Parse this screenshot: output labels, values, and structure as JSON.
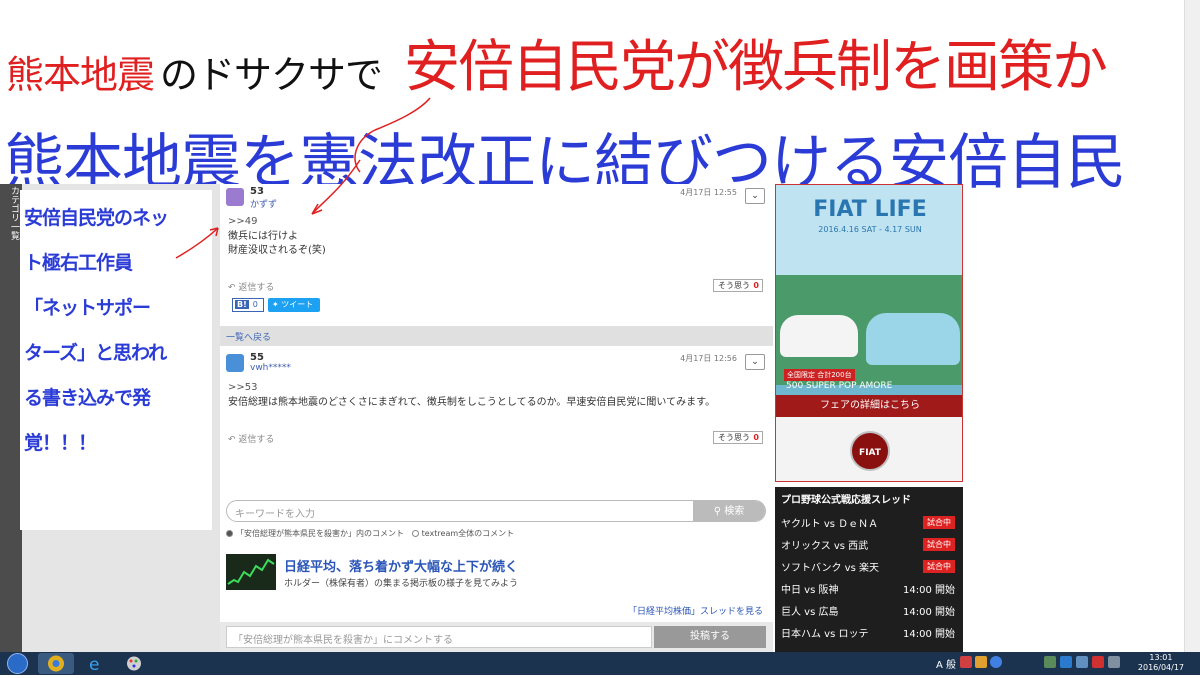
{
  "headline1": {
    "part1": "熊本地震",
    "part2": "のドサクサで",
    "part3": "安倍自民党が徴兵制を画策か"
  },
  "headline2": "熊本地震を憲法改正に結びつける安倍自民",
  "sidebar_category": "カテゴリ一覧",
  "annotation_lines": [
    "安倍自民党のネッ",
    "ト極右工作員",
    "「ネットサポー",
    "ターズ」と思われ",
    "る書き込みで発",
    "覚！！！"
  ],
  "comment53": {
    "num": "53",
    "name": "かずず",
    "date": "4月17日 12:55",
    "ref": ">>49",
    "body1": "徴兵には行けよ",
    "body2": "財産没収されるぞ(笑)",
    "reply": "返信する",
    "sou": "そう思う",
    "sou_count": "0",
    "bm_count": "0",
    "tweet": "ツイート"
  },
  "back_link": "一覧へ戻る",
  "comment55": {
    "num": "55",
    "name": "vwh*****",
    "date": "4月17日 12:56",
    "ref": ">>53",
    "body": "安倍総理は熊本地震のどさくさにまぎれて、徴兵制をしこうとしてるのか。早速安倍自民党に聞いてみます。",
    "reply": "返信する",
    "sou": "そう思う",
    "sou_count": "0"
  },
  "search": {
    "placeholder": "キーワードを入力",
    "button": "検索",
    "radio1": "「安倍総理が熊本県民を殺害か」内のコメント",
    "radio2": "textream全体のコメント"
  },
  "nikkei": {
    "title": "日経平均、落ち着かず大幅な上下が続く",
    "sub": "ホルダー（株保有者）の集まる掲示板の様子を見てみよう",
    "link": "「日経平均株価」スレッドを見る"
  },
  "bottom_comment": {
    "placeholder": "「安倍総理が熊本県民を殺害か」にコメントする",
    "post": "投稿する"
  },
  "ad": {
    "title": "FIAT LIFE",
    "date": "2016.4.16 SAT - 4.17 SUN",
    "limited": "全国限定 合計200台",
    "pop": "500 SUPER POP AMORE",
    "cta": "フェアの詳細はこちら",
    "logo": "FIAT"
  },
  "baseball": {
    "head": "プロ野球公式戦応援スレッド",
    "games": [
      {
        "teams": "ヤクルト vs ＤｅＮＡ",
        "status": "試合中",
        "live": true
      },
      {
        "teams": "オリックス vs 西武",
        "status": "試合中",
        "live": true
      },
      {
        "teams": "ソフトバンク vs 楽天",
        "status": "試合中",
        "live": true
      },
      {
        "teams": "中日 vs 阪神",
        "status": "14:00 開始",
        "live": false
      },
      {
        "teams": "巨人 vs 広島",
        "status": "14:00 開始",
        "live": false
      },
      {
        "teams": "日本ハム vs ロッテ",
        "status": "14:00 開始",
        "live": false
      }
    ]
  },
  "taskbar": {
    "ime": "A 般",
    "time": "13:01",
    "date": "2016/04/17"
  },
  "colors": {
    "headline_red": "#e02020",
    "headline_blue": "#2a3bd6",
    "taskbar": "#1c3350",
    "ad_red": "#a01a1a"
  }
}
